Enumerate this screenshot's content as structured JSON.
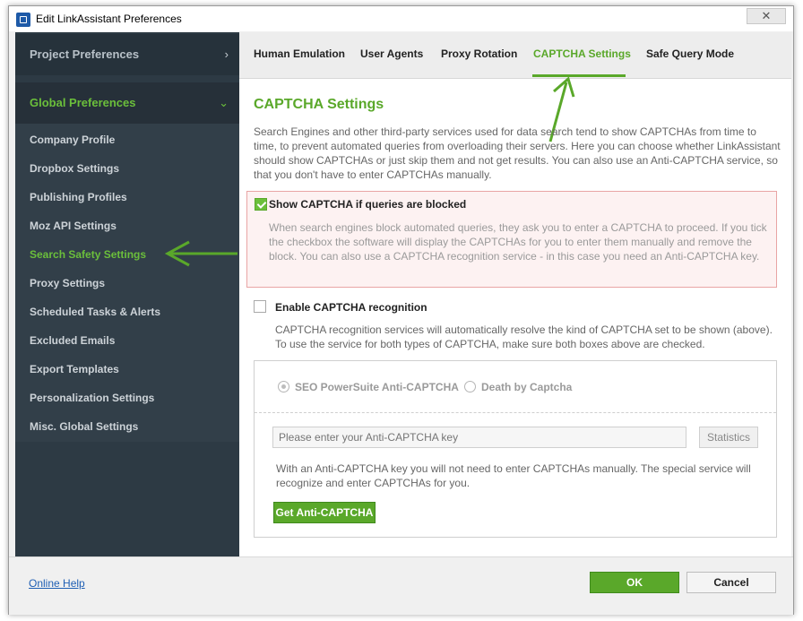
{
  "window": {
    "title": "Edit LinkAssistant Preferences",
    "close_glyph": "✕",
    "icon": "app-icon"
  },
  "sidebar": {
    "project_section": "Project Preferences",
    "global_section": "Global Preferences",
    "items": [
      {
        "label": "Company Profile"
      },
      {
        "label": "Dropbox Settings"
      },
      {
        "label": "Publishing Profiles"
      },
      {
        "label": "Moz API Settings"
      },
      {
        "label": "Search Safety Settings",
        "active": true
      },
      {
        "label": "Proxy Settings"
      },
      {
        "label": "Scheduled Tasks & Alerts"
      },
      {
        "label": "Excluded Emails"
      },
      {
        "label": "Export Templates"
      },
      {
        "label": "Personalization Settings"
      },
      {
        "label": "Misc. Global Settings"
      }
    ]
  },
  "tabs": [
    {
      "label": "Human Emulation"
    },
    {
      "label": "User Agents"
    },
    {
      "label": "Proxy Rotation"
    },
    {
      "label": "CAPTCHA Settings",
      "active": true
    },
    {
      "label": "Safe Query Mode"
    }
  ],
  "main": {
    "heading": "CAPTCHA Settings",
    "intro": "Search Engines and other third-party services used for data search tend to show CAPTCHAs from time to time, to prevent automated queries from overloading their servers. Here you can choose whether LinkAssistant should show CAPTCHAs or just skip them and not get results. You can also use an Anti-CAPTCHA service, so that you don't have to enter CAPTCHAs manually.",
    "show_captcha": {
      "label": "Show CAPTCHA if queries are blocked",
      "checked": true,
      "description": "When search engines block automated queries, they ask you to enter a CAPTCHA to proceed. If you tick the checkbox the software will display the CAPTCHAs for you to enter them manually and remove the block. You can also use a CAPTCHA recognition service - in this case you need an Anti-CAPTCHA key."
    },
    "enable_recognition": {
      "label": "Enable CAPTCHA recognition",
      "checked": false,
      "description": "CAPTCHA recognition services will automatically resolve the kind of CAPTCHA set to be shown (above). To use the service for both types of CAPTCHA, make sure both boxes above are checked."
    },
    "recognition": {
      "option_1": "SEO PowerSuite Anti-CAPTCHA",
      "option_2": "Death by Captcha",
      "key_placeholder": "Please enter your Anti-CAPTCHA key",
      "key_value": "",
      "statistics_button": "Statistics",
      "note": "With an Anti-CAPTCHA key you will not need to enter CAPTCHAs manually. The special service will recognize and enter CAPTCHAs for you.",
      "get_key_button": "Get Anti-CAPTCHA"
    }
  },
  "footer": {
    "help_link": "Online Help",
    "ok_button": "OK",
    "cancel_button": "Cancel"
  },
  "colors": {
    "accent_green": "#5aa82a",
    "sidebar_bg": "#2d3a44",
    "highlight_border": "#e9a5a5"
  }
}
